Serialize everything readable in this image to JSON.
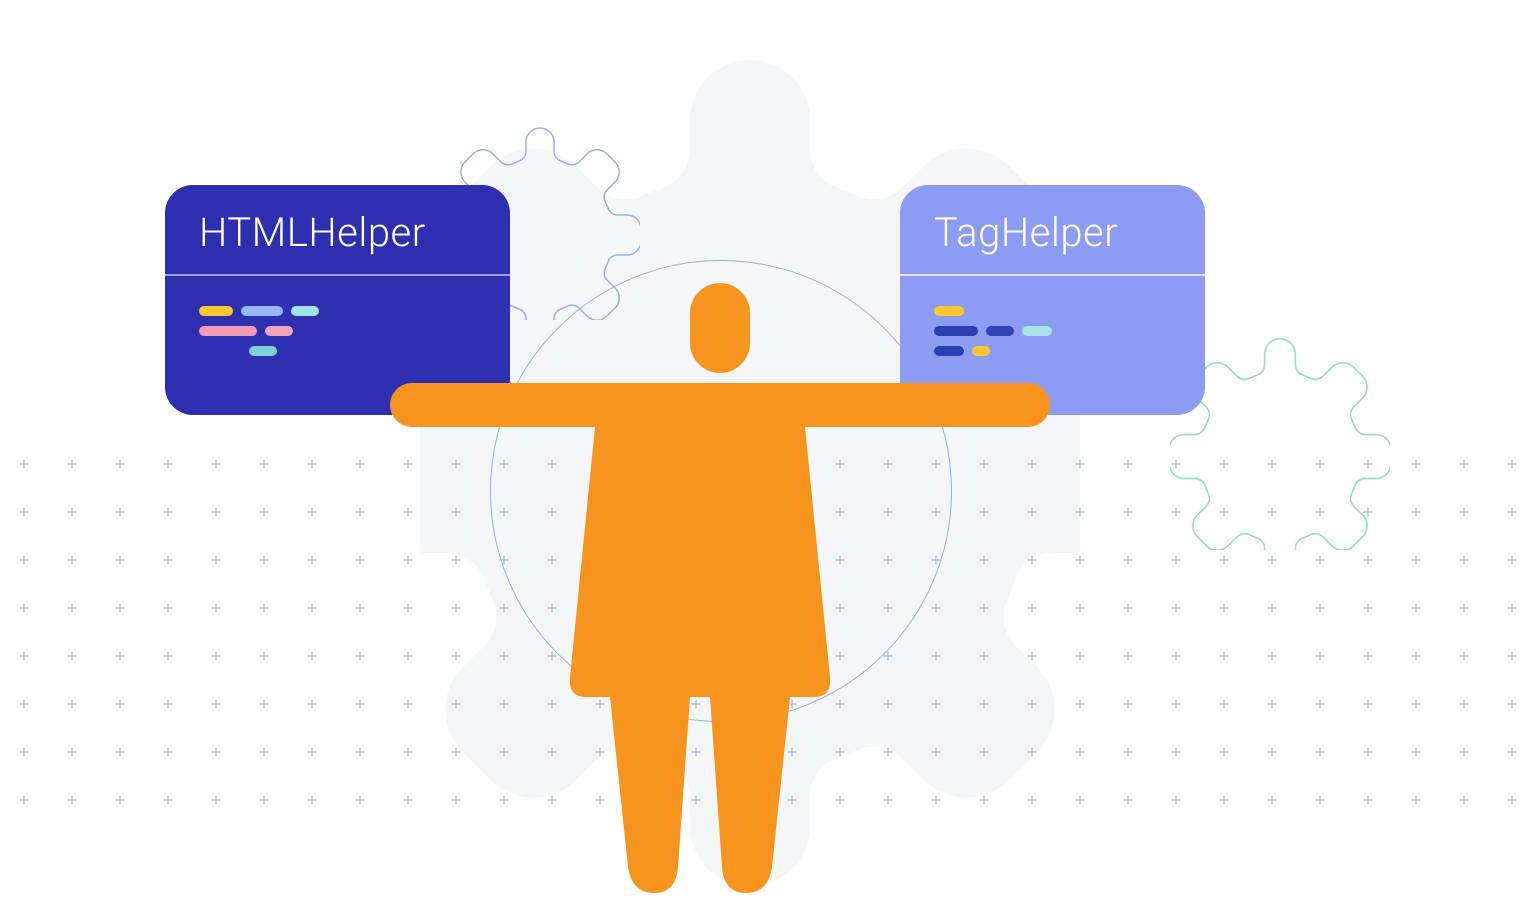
{
  "left_card": {
    "title": "HTMLHelper"
  },
  "right_card": {
    "title": "TagHelper"
  },
  "colors": {
    "left_card_bg": "#2e2fb0",
    "right_card_bg": "#8c9cf3",
    "person": "#f7941d",
    "gear_fill": "#f5f6f8",
    "gear_outline_blue": "#9aaee8",
    "gear_outline_teal": "#95dccb",
    "plus_dot": "#b5c2ee"
  },
  "icons": {
    "person": "person-icon",
    "big_gear": "gear-icon",
    "small_gear_left": "gear-outline-icon",
    "small_gear_right": "gear-outline-icon"
  }
}
